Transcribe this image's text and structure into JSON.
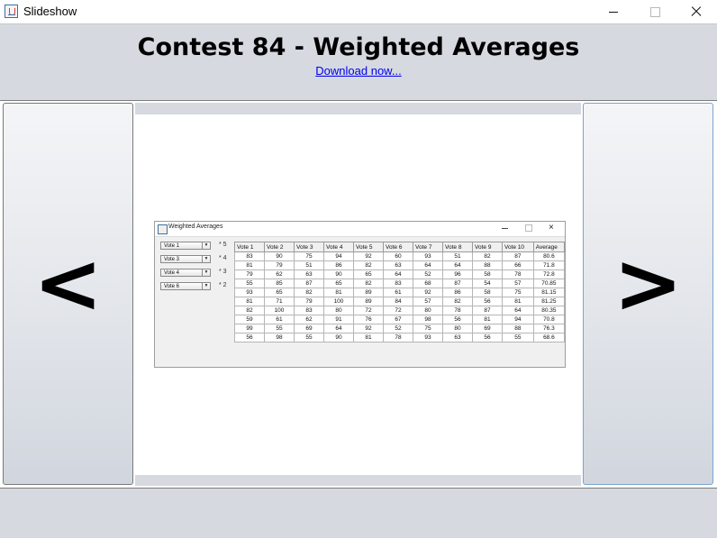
{
  "window": {
    "title": "Slideshow"
  },
  "header": {
    "title": "Contest 84 - Weighted Averages",
    "download_link": "Download now..."
  },
  "nav": {
    "prev_label": "<",
    "next_label": ">"
  },
  "slide": {
    "window_title": "Weighted Averages",
    "dropdowns": [
      {
        "value": "Vote 1",
        "weight": "* 5"
      },
      {
        "value": "Vote 3",
        "weight": "* 4"
      },
      {
        "value": "Vote 4",
        "weight": "* 3"
      },
      {
        "value": "Vote 6",
        "weight": "* 2"
      }
    ],
    "table": {
      "headers": [
        "Vote 1",
        "Vote 2",
        "Vote 3",
        "Vote 4",
        "Vote 5",
        "Vote 6",
        "Vote 7",
        "Vote 8",
        "Vote 9",
        "Vote 10",
        "Average"
      ],
      "rows": [
        [
          "83",
          "90",
          "75",
          "94",
          "92",
          "60",
          "93",
          "51",
          "82",
          "87",
          "80.6"
        ],
        [
          "81",
          "79",
          "51",
          "86",
          "82",
          "63",
          "64",
          "64",
          "88",
          "66",
          "71.8"
        ],
        [
          "79",
          "62",
          "63",
          "90",
          "65",
          "64",
          "52",
          "96",
          "58",
          "78",
          "72.8"
        ],
        [
          "55",
          "85",
          "87",
          "65",
          "82",
          "83",
          "68",
          "87",
          "54",
          "57",
          "70.85"
        ],
        [
          "93",
          "65",
          "82",
          "81",
          "89",
          "61",
          "92",
          "86",
          "58",
          "75",
          "81.15"
        ],
        [
          "81",
          "71",
          "79",
          "100",
          "89",
          "84",
          "57",
          "82",
          "56",
          "81",
          "81.25"
        ],
        [
          "82",
          "100",
          "83",
          "80",
          "72",
          "72",
          "80",
          "78",
          "87",
          "64",
          "80.35"
        ],
        [
          "59",
          "61",
          "62",
          "91",
          "76",
          "67",
          "98",
          "56",
          "81",
          "94",
          "70.8"
        ],
        [
          "99",
          "55",
          "69",
          "64",
          "92",
          "52",
          "75",
          "80",
          "69",
          "88",
          "76.3"
        ],
        [
          "56",
          "98",
          "55",
          "90",
          "81",
          "78",
          "93",
          "63",
          "56",
          "55",
          "68.6"
        ]
      ]
    }
  },
  "colors": {
    "panel": "#d6d9df",
    "link": "#0000ee"
  }
}
